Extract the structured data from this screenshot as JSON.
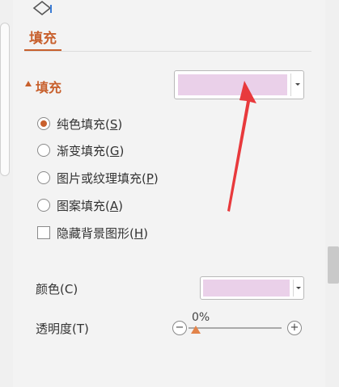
{
  "tab": {
    "icon": "fill-bucket-icon",
    "label": "填充"
  },
  "fill_section": {
    "title": "填充",
    "dropdown": {
      "swatch_color": "#ead0e9"
    },
    "options": [
      {
        "label": "纯色填充(",
        "key": "S",
        "tail": ")",
        "checked": true
      },
      {
        "label": "渐变填充(",
        "key": "G",
        "tail": ")",
        "checked": false
      },
      {
        "label": "图片或纹理填充(",
        "key": "P",
        "tail": ")",
        "checked": false
      },
      {
        "label": "图案填充(",
        "key": "A",
        "tail": ")",
        "checked": false
      }
    ],
    "hide_background": {
      "label": "隐藏背景图形(",
      "key": "H",
      "tail": ")",
      "checked": false
    }
  },
  "color": {
    "label": "颜色(C)",
    "swatch_color": "#ead0e9"
  },
  "transparency": {
    "label": "透明度(T)",
    "value": "0%",
    "fraction": 0.0,
    "minus": "−",
    "plus": "+"
  },
  "accent_color": "#c8602d",
  "annotation_color": "#e8393c"
}
